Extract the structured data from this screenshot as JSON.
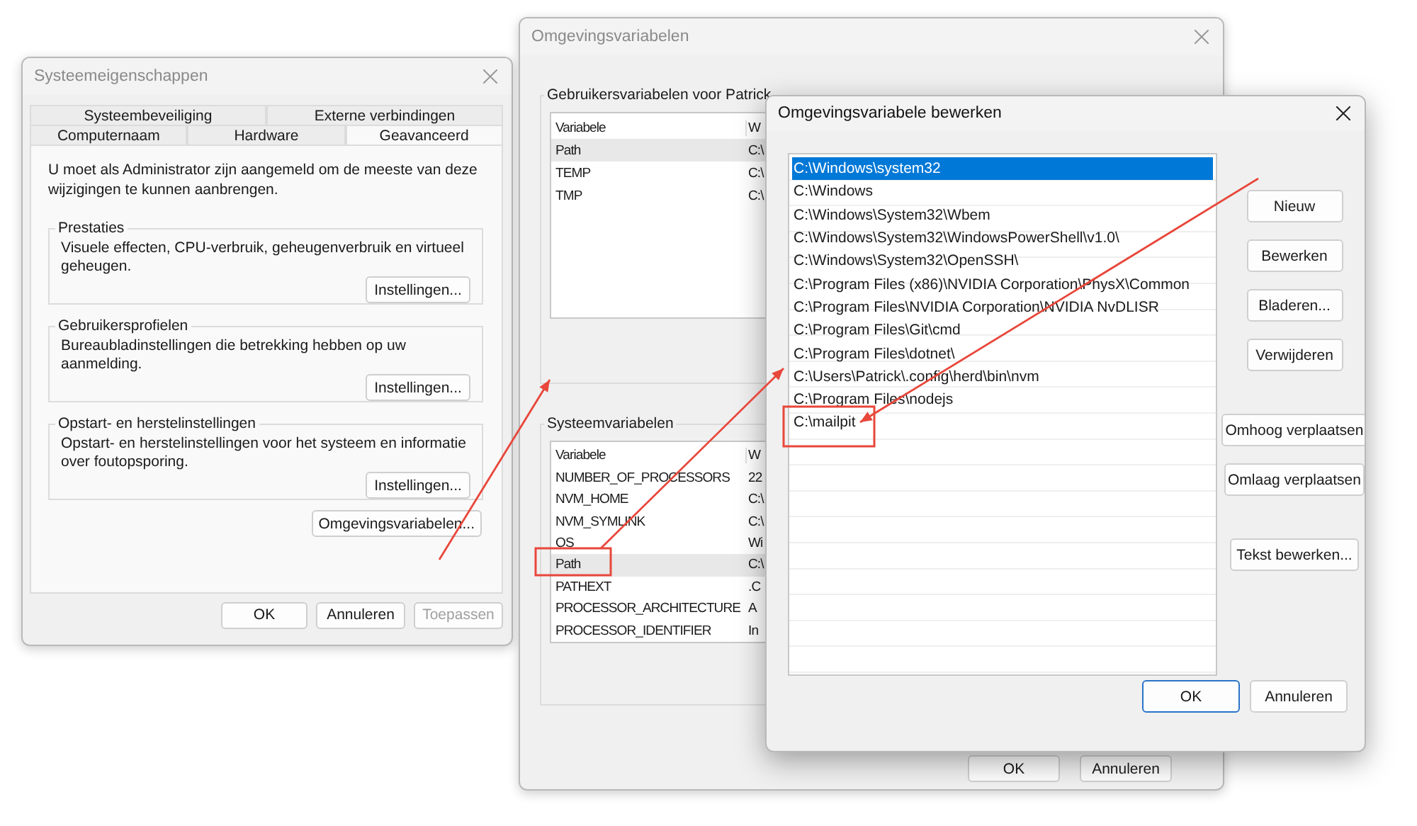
{
  "system_properties": {
    "title": "Systeemeigenschappen",
    "tab_rows": [
      [
        {
          "label": "Systeembeveiliging",
          "selected": false
        },
        {
          "label": "Externe verbindingen",
          "selected": false
        }
      ],
      [
        {
          "label": "Computernaam",
          "selected": false
        },
        {
          "label": "Hardware",
          "selected": false
        },
        {
          "label": "Geavanceerd",
          "selected": true
        }
      ]
    ],
    "notice": "U moet als Administrator zijn aangemeld om de meeste van deze wijzigingen te kunnen aanbrengen.",
    "groups": [
      {
        "title": "Prestaties",
        "description": "Visuele effecten, CPU-verbruik, geheugenverbruik en virtueel geheugen.",
        "button": "Instellingen..."
      },
      {
        "title": "Gebruikersprofielen",
        "description": "Bureaubladinstellingen die betrekking hebben op uw aanmelding.",
        "button": "Instellingen..."
      },
      {
        "title": "Opstart- en herstelinstellingen",
        "description": "Opstart- en herstelinstellingen voor het systeem en informatie over foutopsporing.",
        "button": "Instellingen..."
      }
    ],
    "env_button": "Omgevingsvariabelen...",
    "buttons": [
      {
        "label": "OK",
        "disabled": false
      },
      {
        "label": "Annuleren",
        "disabled": false
      },
      {
        "label": "Toepassen",
        "disabled": true
      }
    ]
  },
  "environment_variables": {
    "title": "Omgevingsvariabelen",
    "user_section": {
      "title": "Gebruikersvariabelen voor Patrick",
      "columns": [
        "Variabele",
        "W"
      ],
      "rows": [
        {
          "name": "Path",
          "value": "C:\\",
          "selected": true
        },
        {
          "name": "TEMP",
          "value": "C:\\",
          "selected": false
        },
        {
          "name": "TMP",
          "value": "C:\\",
          "selected": false
        }
      ]
    },
    "system_section": {
      "title": "Systeemvariabelen",
      "columns": [
        "Variabele",
        "W"
      ],
      "rows": [
        {
          "name": "NUMBER_OF_PROCESSORS",
          "value": "22",
          "selected": false
        },
        {
          "name": "NVM_HOME",
          "value": "C:\\",
          "selected": false
        },
        {
          "name": "NVM_SYMLINK",
          "value": "C:\\",
          "selected": false
        },
        {
          "name": "OS",
          "value": "Wi",
          "selected": false
        },
        {
          "name": "Path",
          "value": "C:\\",
          "selected": true
        },
        {
          "name": "PATHEXT",
          "value": ".C",
          "selected": false
        },
        {
          "name": "PROCESSOR_ARCHITECTURE",
          "value": "A",
          "selected": false
        },
        {
          "name": "PROCESSOR_IDENTIFIER",
          "value": "In",
          "selected": false
        }
      ]
    },
    "buttons": [
      "OK",
      "Annuleren"
    ]
  },
  "edit_variable": {
    "title": "Omgevingsvariabele bewerken",
    "entries": [
      {
        "text": "C:\\Windows\\system32",
        "selected": true
      },
      {
        "text": "C:\\Windows",
        "selected": false
      },
      {
        "text": "C:\\Windows\\System32\\Wbem",
        "selected": false
      },
      {
        "text": "C:\\Windows\\System32\\WindowsPowerShell\\v1.0\\",
        "selected": false
      },
      {
        "text": "C:\\Windows\\System32\\OpenSSH\\",
        "selected": false
      },
      {
        "text": "C:\\Program Files (x86)\\NVIDIA Corporation\\PhysX\\Common",
        "selected": false
      },
      {
        "text": "C:\\Program Files\\NVIDIA Corporation\\NVIDIA NvDLISR",
        "selected": false
      },
      {
        "text": "C:\\Program Files\\Git\\cmd",
        "selected": false
      },
      {
        "text": "C:\\Program Files\\dotnet\\",
        "selected": false
      },
      {
        "text": "C:\\Users\\Patrick\\.config\\herd\\bin\\nvm",
        "selected": false
      },
      {
        "text": "C:\\Program Files\\nodejs",
        "selected": false
      },
      {
        "text": "C:\\mailpit",
        "selected": false
      }
    ],
    "side_buttons": [
      {
        "label": "Nieuw",
        "kind": "narrow"
      },
      {
        "label": "Bewerken",
        "kind": "narrow"
      },
      {
        "label": "Bladeren...",
        "kind": "narrow"
      },
      {
        "label": "Verwijderen",
        "kind": "narrow"
      },
      {
        "label": "Omhoog verplaatsen",
        "kind": "wide"
      },
      {
        "label": "Omlaag verplaatsen",
        "kind": "wide"
      },
      {
        "label": "Tekst bewerken...",
        "kind": "medium"
      }
    ],
    "buttons": [
      {
        "label": "OK",
        "default": true
      },
      {
        "label": "Annuleren",
        "default": false
      }
    ]
  }
}
